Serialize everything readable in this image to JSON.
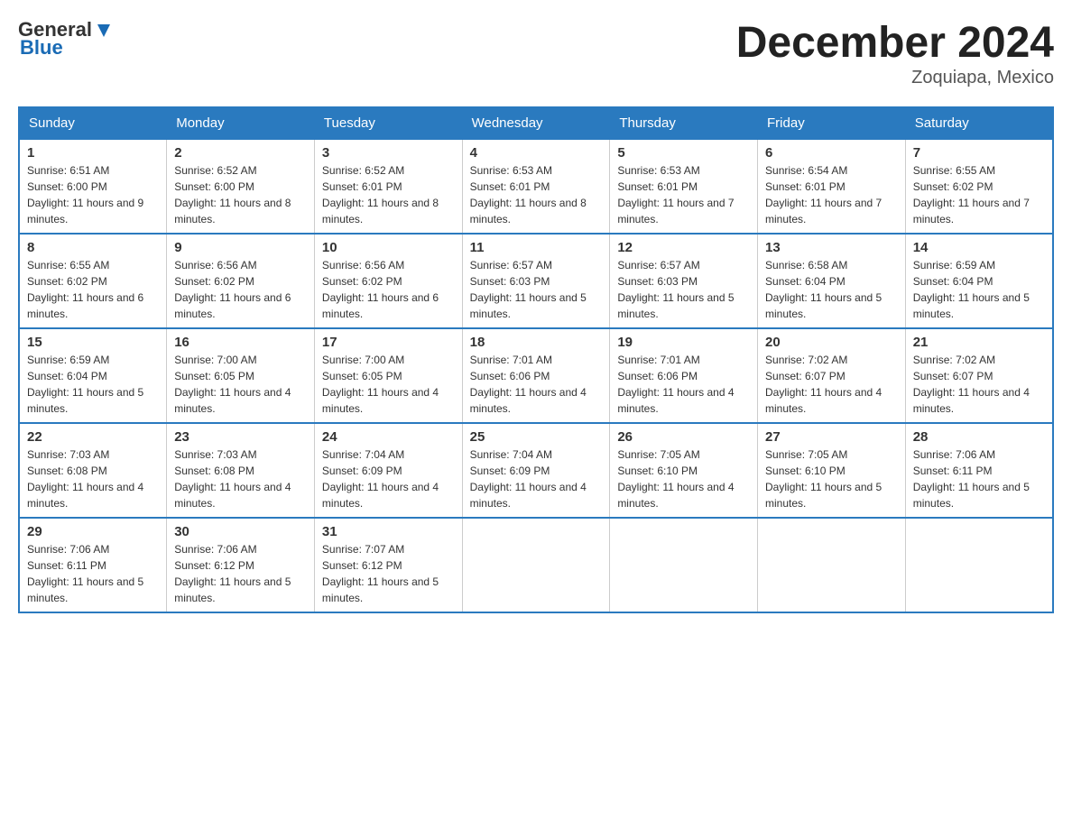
{
  "header": {
    "logo": {
      "text1": "General",
      "text2": "Blue"
    },
    "title": "December 2024",
    "location": "Zoquiapa, Mexico"
  },
  "days_of_week": [
    "Sunday",
    "Monday",
    "Tuesday",
    "Wednesday",
    "Thursday",
    "Friday",
    "Saturday"
  ],
  "weeks": [
    [
      {
        "day": "1",
        "sunrise": "6:51 AM",
        "sunset": "6:00 PM",
        "daylight": "11 hours and 9 minutes."
      },
      {
        "day": "2",
        "sunrise": "6:52 AM",
        "sunset": "6:00 PM",
        "daylight": "11 hours and 8 minutes."
      },
      {
        "day": "3",
        "sunrise": "6:52 AM",
        "sunset": "6:01 PM",
        "daylight": "11 hours and 8 minutes."
      },
      {
        "day": "4",
        "sunrise": "6:53 AM",
        "sunset": "6:01 PM",
        "daylight": "11 hours and 8 minutes."
      },
      {
        "day": "5",
        "sunrise": "6:53 AM",
        "sunset": "6:01 PM",
        "daylight": "11 hours and 7 minutes."
      },
      {
        "day": "6",
        "sunrise": "6:54 AM",
        "sunset": "6:01 PM",
        "daylight": "11 hours and 7 minutes."
      },
      {
        "day": "7",
        "sunrise": "6:55 AM",
        "sunset": "6:02 PM",
        "daylight": "11 hours and 7 minutes."
      }
    ],
    [
      {
        "day": "8",
        "sunrise": "6:55 AM",
        "sunset": "6:02 PM",
        "daylight": "11 hours and 6 minutes."
      },
      {
        "day": "9",
        "sunrise": "6:56 AM",
        "sunset": "6:02 PM",
        "daylight": "11 hours and 6 minutes."
      },
      {
        "day": "10",
        "sunrise": "6:56 AM",
        "sunset": "6:02 PM",
        "daylight": "11 hours and 6 minutes."
      },
      {
        "day": "11",
        "sunrise": "6:57 AM",
        "sunset": "6:03 PM",
        "daylight": "11 hours and 5 minutes."
      },
      {
        "day": "12",
        "sunrise": "6:57 AM",
        "sunset": "6:03 PM",
        "daylight": "11 hours and 5 minutes."
      },
      {
        "day": "13",
        "sunrise": "6:58 AM",
        "sunset": "6:04 PM",
        "daylight": "11 hours and 5 minutes."
      },
      {
        "day": "14",
        "sunrise": "6:59 AM",
        "sunset": "6:04 PM",
        "daylight": "11 hours and 5 minutes."
      }
    ],
    [
      {
        "day": "15",
        "sunrise": "6:59 AM",
        "sunset": "6:04 PM",
        "daylight": "11 hours and 5 minutes."
      },
      {
        "day": "16",
        "sunrise": "7:00 AM",
        "sunset": "6:05 PM",
        "daylight": "11 hours and 4 minutes."
      },
      {
        "day": "17",
        "sunrise": "7:00 AM",
        "sunset": "6:05 PM",
        "daylight": "11 hours and 4 minutes."
      },
      {
        "day": "18",
        "sunrise": "7:01 AM",
        "sunset": "6:06 PM",
        "daylight": "11 hours and 4 minutes."
      },
      {
        "day": "19",
        "sunrise": "7:01 AM",
        "sunset": "6:06 PM",
        "daylight": "11 hours and 4 minutes."
      },
      {
        "day": "20",
        "sunrise": "7:02 AM",
        "sunset": "6:07 PM",
        "daylight": "11 hours and 4 minutes."
      },
      {
        "day": "21",
        "sunrise": "7:02 AM",
        "sunset": "6:07 PM",
        "daylight": "11 hours and 4 minutes."
      }
    ],
    [
      {
        "day": "22",
        "sunrise": "7:03 AM",
        "sunset": "6:08 PM",
        "daylight": "11 hours and 4 minutes."
      },
      {
        "day": "23",
        "sunrise": "7:03 AM",
        "sunset": "6:08 PM",
        "daylight": "11 hours and 4 minutes."
      },
      {
        "day": "24",
        "sunrise": "7:04 AM",
        "sunset": "6:09 PM",
        "daylight": "11 hours and 4 minutes."
      },
      {
        "day": "25",
        "sunrise": "7:04 AM",
        "sunset": "6:09 PM",
        "daylight": "11 hours and 4 minutes."
      },
      {
        "day": "26",
        "sunrise": "7:05 AM",
        "sunset": "6:10 PM",
        "daylight": "11 hours and 4 minutes."
      },
      {
        "day": "27",
        "sunrise": "7:05 AM",
        "sunset": "6:10 PM",
        "daylight": "11 hours and 5 minutes."
      },
      {
        "day": "28",
        "sunrise": "7:06 AM",
        "sunset": "6:11 PM",
        "daylight": "11 hours and 5 minutes."
      }
    ],
    [
      {
        "day": "29",
        "sunrise": "7:06 AM",
        "sunset": "6:11 PM",
        "daylight": "11 hours and 5 minutes."
      },
      {
        "day": "30",
        "sunrise": "7:06 AM",
        "sunset": "6:12 PM",
        "daylight": "11 hours and 5 minutes."
      },
      {
        "day": "31",
        "sunrise": "7:07 AM",
        "sunset": "6:12 PM",
        "daylight": "11 hours and 5 minutes."
      },
      null,
      null,
      null,
      null
    ]
  ]
}
